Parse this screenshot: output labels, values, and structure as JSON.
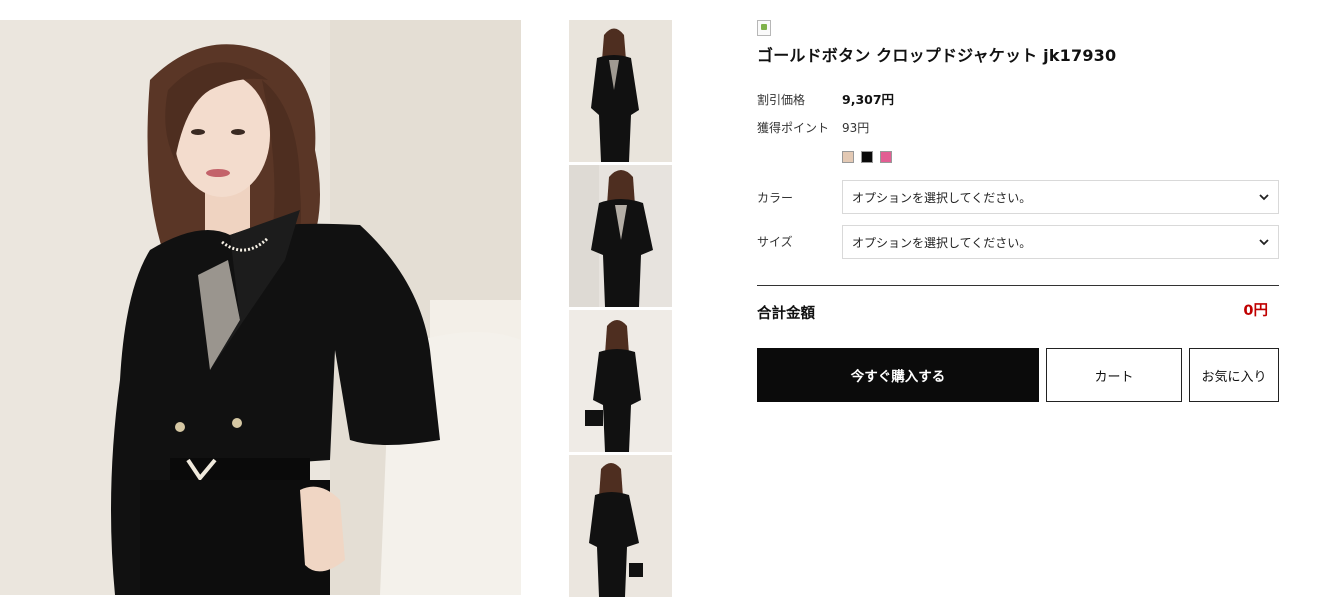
{
  "product": {
    "title": "ゴールドボタン クロップドジャケット jk17930",
    "price_label": "割引価格",
    "price_value": "9,307円",
    "points_label": "獲得ポイント",
    "points_value": "93円"
  },
  "swatches": [
    {
      "name": "beige",
      "color": "#e3c9b4"
    },
    {
      "name": "black",
      "color": "#0a0a0a"
    },
    {
      "name": "pink",
      "color": "#e25e93"
    }
  ],
  "options": [
    {
      "label": "カラー",
      "placeholder": "オプションを選択してください。"
    },
    {
      "label": "サイズ",
      "placeholder": "オプションを選択してください。"
    }
  ],
  "total": {
    "label": "合計金額",
    "value": "0円"
  },
  "buttons": {
    "buy": "今すぐ購入する",
    "cart": "カート",
    "favorite": "お気に入り"
  },
  "colors": {
    "accent_red": "#c00000",
    "buy_button": "#0b0b0b"
  }
}
